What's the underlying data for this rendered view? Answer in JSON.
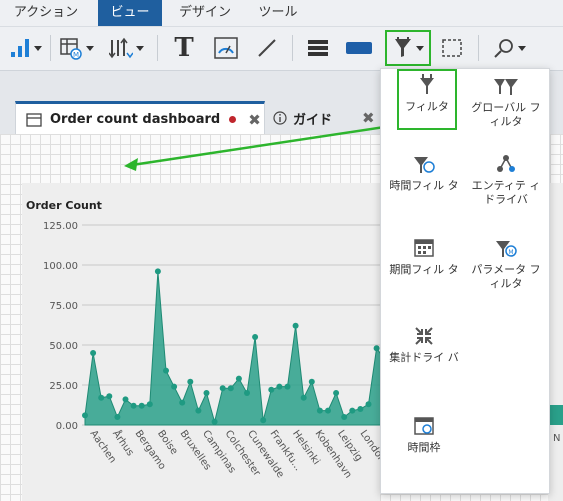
{
  "menu": {
    "items": [
      {
        "label": "アクション",
        "active": false
      },
      {
        "label": "ビュー",
        "active": true
      },
      {
        "label": "デザイン",
        "active": false
      },
      {
        "label": "ツール",
        "active": false
      }
    ]
  },
  "toolbar": {
    "text_tool_glyph": "T",
    "highlight_color": "#2db52d"
  },
  "tabs": [
    {
      "label": "Order count dashboard",
      "modified": true
    },
    {
      "label": "ガイド",
      "modified": false
    }
  ],
  "popup": {
    "items": [
      {
        "label": "フィルタ",
        "icon": "filter-icon",
        "highlighted": true
      },
      {
        "label": "グローバル フィルタ",
        "icon": "global-filter-icon"
      },
      {
        "label": "時間フィル タ",
        "icon": "time-filter-icon"
      },
      {
        "label": "エンティテ ィドライバ",
        "icon": "entity-driver-icon"
      },
      {
        "label": "期間フィル タ",
        "icon": "period-filter-icon"
      },
      {
        "label": "パラメータ フィルタ",
        "icon": "parameter-filter-icon"
      },
      {
        "label": "集計ドライ バ",
        "icon": "aggregate-driver-icon"
      },
      {
        "label": "時間枠",
        "icon": "time-frame-icon"
      }
    ]
  },
  "chart_data": {
    "type": "area",
    "title": "Order Count",
    "ylim": [
      0,
      125
    ],
    "yticks": [
      "0.00",
      "25.00",
      "50.00",
      "75.00",
      "100.00",
      "125.00"
    ],
    "x_labels": [
      "Aachen",
      "Århus",
      "Bergamo",
      "Boise",
      "Bruxelles",
      "Campinas",
      "Colchester",
      "Cunewalde",
      "Frankfu...",
      "Helsinki",
      "Kobenhavn",
      "Leipzig",
      "London",
      "N..."
    ],
    "values": [
      6,
      45,
      17,
      18,
      5,
      16,
      12,
      12,
      13,
      96,
      34,
      24,
      14,
      27,
      9,
      20,
      2,
      23,
      23,
      29,
      20,
      55,
      3,
      22,
      24,
      24,
      62,
      17,
      27,
      9,
      9,
      20,
      5,
      9,
      10,
      13,
      48,
      41,
      13
    ],
    "color": "#2aa08a",
    "grid": true
  }
}
